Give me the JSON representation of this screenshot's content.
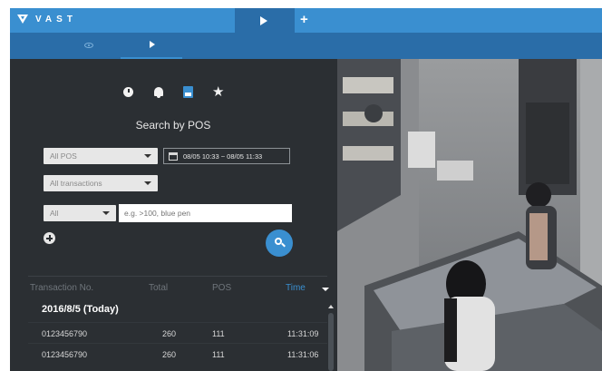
{
  "app": {
    "brand": "VAST",
    "accent_color": "#3a8fd0",
    "dark_accent_color": "#2a6da8",
    "panel_color": "#2b2f33"
  },
  "topbar": {
    "tabs": [
      {
        "icon": "play-icon",
        "active": true
      },
      {
        "icon": "plus-icon",
        "label": "+"
      }
    ]
  },
  "subbar": {
    "tabs": [
      {
        "icon": "eye-icon",
        "active": false
      },
      {
        "icon": "play-icon",
        "active": true
      }
    ]
  },
  "search": {
    "mode_icons": [
      "clock-icon",
      "bell-icon",
      "pos-icon",
      "star-icon"
    ],
    "title": "Search by POS",
    "pos_select": "All POS",
    "date_range": "08/05 10:33 ~ 08/05 11:33",
    "transaction_select": "All transactions",
    "field_select": "All",
    "keyword_placeholder": "e.g. >100, blue pen"
  },
  "table": {
    "columns": [
      "Transaction No.",
      "Total",
      "POS",
      "Time"
    ],
    "sorted_column": "Time",
    "group_label": "2016/8/5 (Today)",
    "rows": [
      {
        "txn": "0123456790",
        "total": "260",
        "pos": "111",
        "time": "11:31:09"
      },
      {
        "txn": "0123456790",
        "total": "260",
        "pos": "111",
        "time": "11:31:06"
      }
    ]
  }
}
